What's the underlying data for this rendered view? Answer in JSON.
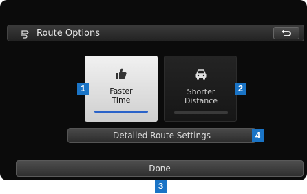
{
  "header": {
    "title": "Route Options",
    "title_icon": "route-options-icon",
    "back_icon": "back-arrow-icon"
  },
  "options": [
    {
      "line1": "Faster",
      "line2": "Time",
      "icon": "thumbs-up-icon",
      "selected": true,
      "badge": "1"
    },
    {
      "line1": "Shorter",
      "line2": "Distance",
      "icon": "car-icon",
      "selected": false,
      "badge": "2"
    }
  ],
  "detail_button": {
    "label": "Detailed Route Settings",
    "badge": "4"
  },
  "done_button": {
    "label": "Done",
    "badge": "3"
  },
  "colors": {
    "accent": "#2b63c9",
    "badge": "#1a74c6",
    "background": "#0b0b0b"
  }
}
